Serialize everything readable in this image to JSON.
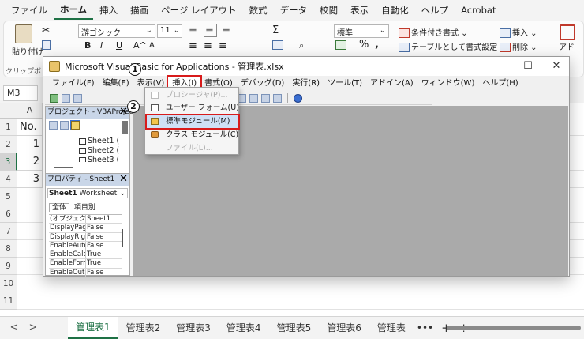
{
  "excel": {
    "tabs": [
      "ファイル",
      "ホーム",
      "挿入",
      "描画",
      "ページ レイアウト",
      "数式",
      "データ",
      "校閲",
      "表示",
      "自動化",
      "ヘルプ",
      "Acrobat"
    ],
    "active_tab": "ホーム",
    "ribbon": {
      "paste": "貼り付け",
      "clipboard": "クリップボ",
      "font_name": "游ゴシック",
      "font_size": "11",
      "bold": "B",
      "italic": "I",
      "underline": "U",
      "font_grow": "A^",
      "font_shrink": "A",
      "sum": "Σ",
      "number_format": "標準",
      "percent": "%",
      "conditional_format": "条件付き書式",
      "format_as_table": "テーブルとして書式設定",
      "insert": "挿入",
      "delete": "削除",
      "addin": "アド"
    },
    "name_box": "M3",
    "column_a": "A",
    "rows": [
      "1",
      "2",
      "3",
      "4",
      "5",
      "6",
      "7",
      "8",
      "9",
      "10",
      "11"
    ],
    "cells": {
      "a1": "No.",
      "a2": "1",
      "a3": "2",
      "a4": "3"
    },
    "sheets": [
      "管理表1",
      "管理表2",
      "管理表3",
      "管理表4",
      "管理表5",
      "管理表6",
      "管理表"
    ],
    "sheet_more": "•••",
    "sheet_add": "+",
    "nav_prev": "<",
    "nav_next": ">"
  },
  "vbe": {
    "title": "Microsoft Visual Basic for Applications - 管理表.xlsx",
    "min": "—",
    "max": "☐",
    "close": "✕",
    "menus": [
      "ファイル(F)",
      "編集(E)",
      "表示(V)",
      "挿入(I)",
      "書式(O)",
      "デバッグ(D)",
      "実行(R)",
      "ツール(T)",
      "アドイン(A)",
      "ウィンドウ(W)",
      "ヘルプ(H)"
    ],
    "open_menu": "挿入(I)",
    "project_title": "プロジェクト - VBAProject",
    "project_items": [
      "Sheet1 (",
      "Sheet2 (",
      "Sheet3 ("
    ],
    "props_title": "プロパティ - Sheet1",
    "props_object": "Sheet1",
    "props_object_type": "Worksheet",
    "props_tab_all": "全体",
    "props_tab_category": "項目別",
    "props": [
      {
        "k": "(オブジェクト名)",
        "v": "Sheet1"
      },
      {
        "k": "DisplayPageBreaks",
        "v": "False"
      },
      {
        "k": "DisplayRightToLeft",
        "v": "False"
      },
      {
        "k": "EnableAutoFilter",
        "v": "False"
      },
      {
        "k": "EnableCalculation",
        "v": "True"
      },
      {
        "k": "EnableFormatConditionsCalculation",
        "v": "True"
      },
      {
        "k": "EnableOutlining",
        "v": "False"
      }
    ],
    "insert_menu": [
      {
        "label": "プロシージャ(P)...",
        "state": "disabled"
      },
      {
        "label": "ユーザー フォーム(U)",
        "state": "normal"
      },
      {
        "label": "標準モジュール(M)",
        "state": "highlight"
      },
      {
        "label": "クラス モジュール(C)",
        "state": "normal"
      },
      {
        "label": "ファイル(L)...",
        "state": "disabled"
      }
    ]
  },
  "callouts": {
    "step1": "1",
    "step2": "2"
  },
  "colors": {
    "excel_green": "#1e7145",
    "highlight_red": "#d81b1b",
    "menu_highlight": "#cfe0f5",
    "code_bg": "#aaaaaa"
  }
}
